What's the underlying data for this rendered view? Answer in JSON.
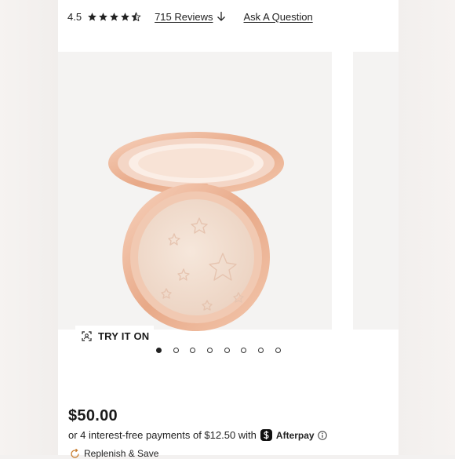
{
  "rating": {
    "value": "4.5",
    "stars": 4.5,
    "reviews_label": "715 Reviews",
    "ask_label": "Ask A Question"
  },
  "gallery": {
    "try_on_label": "TRY IT ON",
    "dot_count": 8,
    "active_index": 0
  },
  "price": {
    "amount": "$50.00",
    "installment_text": "or 4 interest-free payments of $12.50 with",
    "provider": "Afterpay"
  },
  "replenish": {
    "label": "Replenish & Save"
  },
  "colors": {
    "accent": "#222222",
    "product_gold": "#e9b59a",
    "pan": "#f1dccd"
  },
  "icons": [
    "star-icon",
    "arrow-down-icon",
    "scan-icon",
    "afterpay-logo-icon",
    "info-icon",
    "replenish-icon"
  ]
}
